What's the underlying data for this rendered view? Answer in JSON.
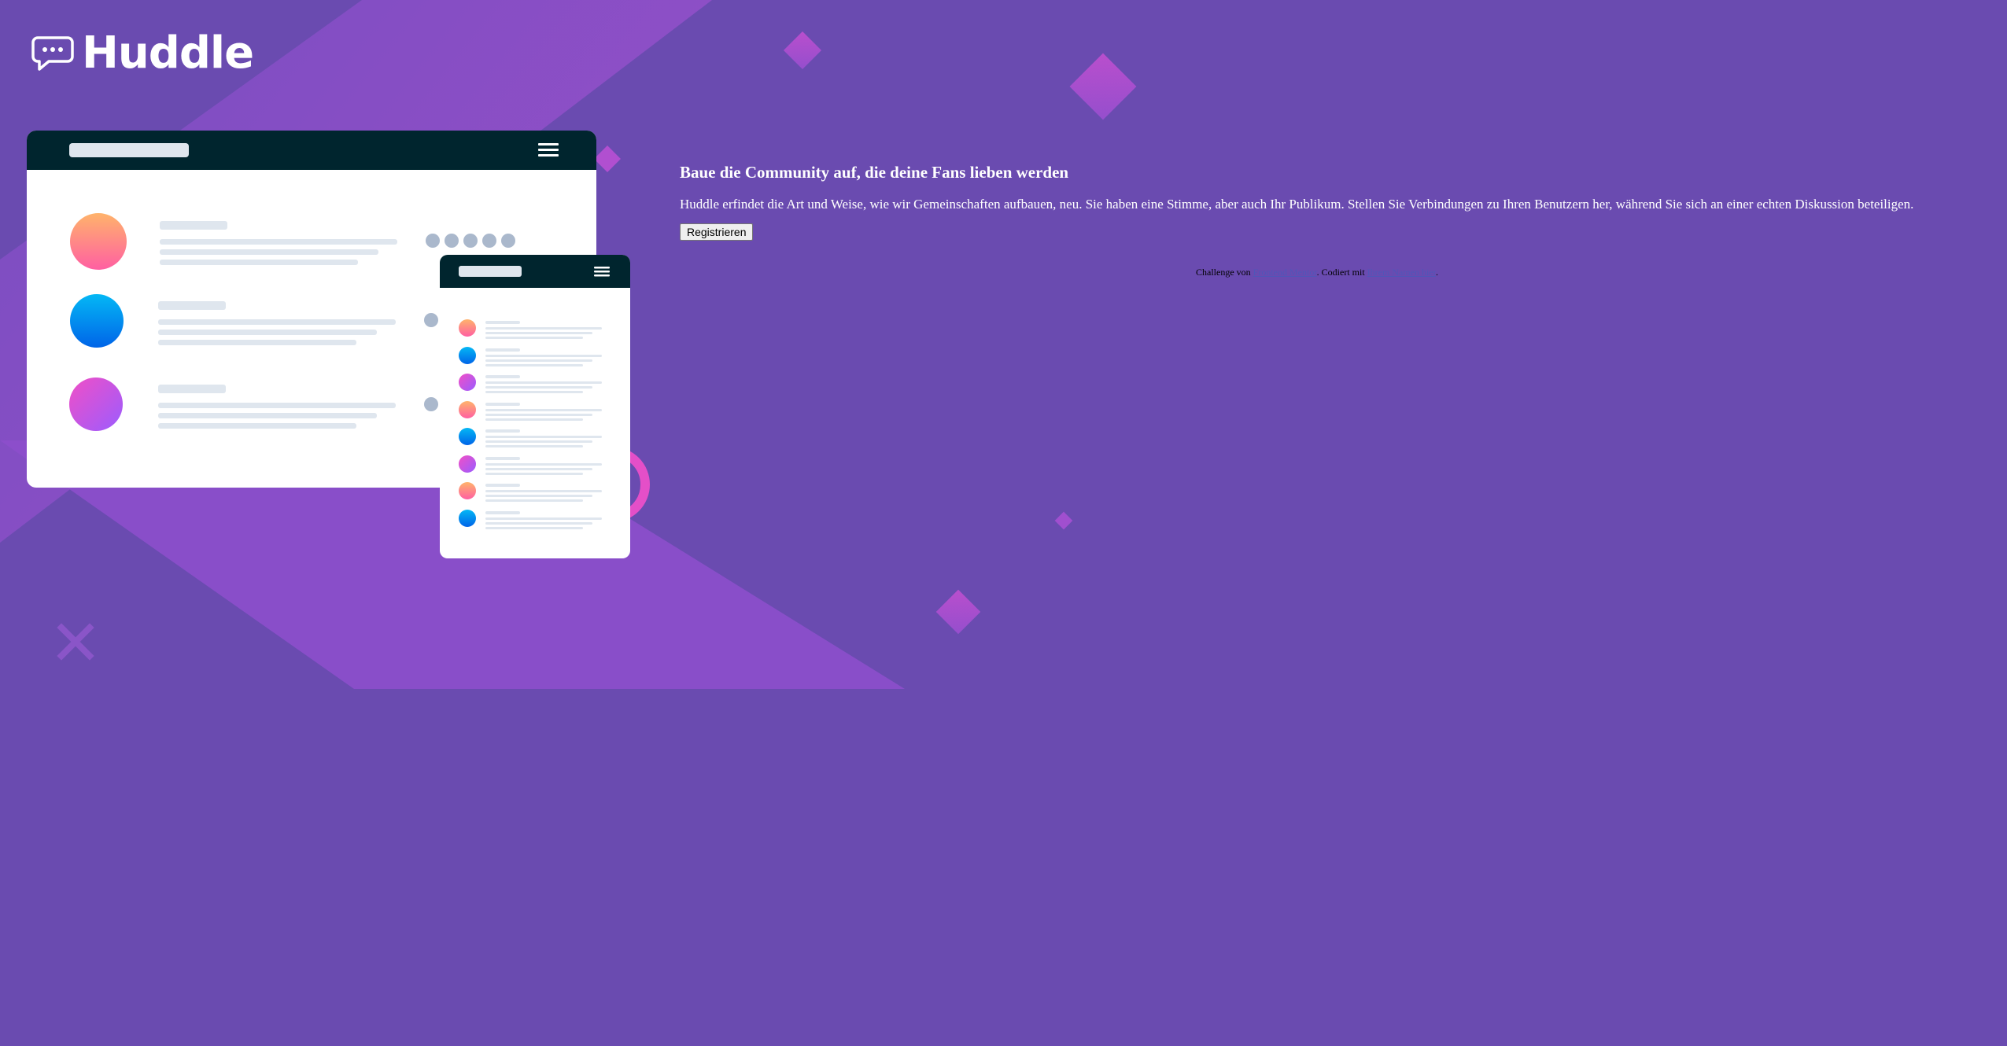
{
  "colors": {
    "background": "#6a4bb0",
    "accent_violet": "#9a4fd0",
    "accent_pink": "#e94fc8",
    "mockup_header": "#00252e",
    "button_bg": "#efefef",
    "white": "#ffffff"
  },
  "brand": {
    "name": "Huddle",
    "logo_icon": "speech-bubble-icon"
  },
  "hero": {
    "title": "Baue die Community auf, die deine Fans lieben werden",
    "description": "Huddle erfindet die Art und Weise, wie wir Gemeinschaften aufbauen, neu. Sie haben eine Stimme, aber auch Ihr Publikum. Stellen Sie Verbindungen zu Ihren Benutzern her, während Sie sich an einer echten Diskussion beteiligen.",
    "cta_label": "Registrieren"
  },
  "footer": {
    "challenge_prefix": "Challenge von ",
    "challenge_link": "Frontend Mentor",
    "coded_prefix": ". Codiert mit ",
    "coded_link": "Ihrem Namen hier",
    "suffix": "."
  },
  "illustration": {
    "desktop_menu_icon": "hamburger-icon",
    "mobile_menu_icon": "hamburger-icon"
  }
}
